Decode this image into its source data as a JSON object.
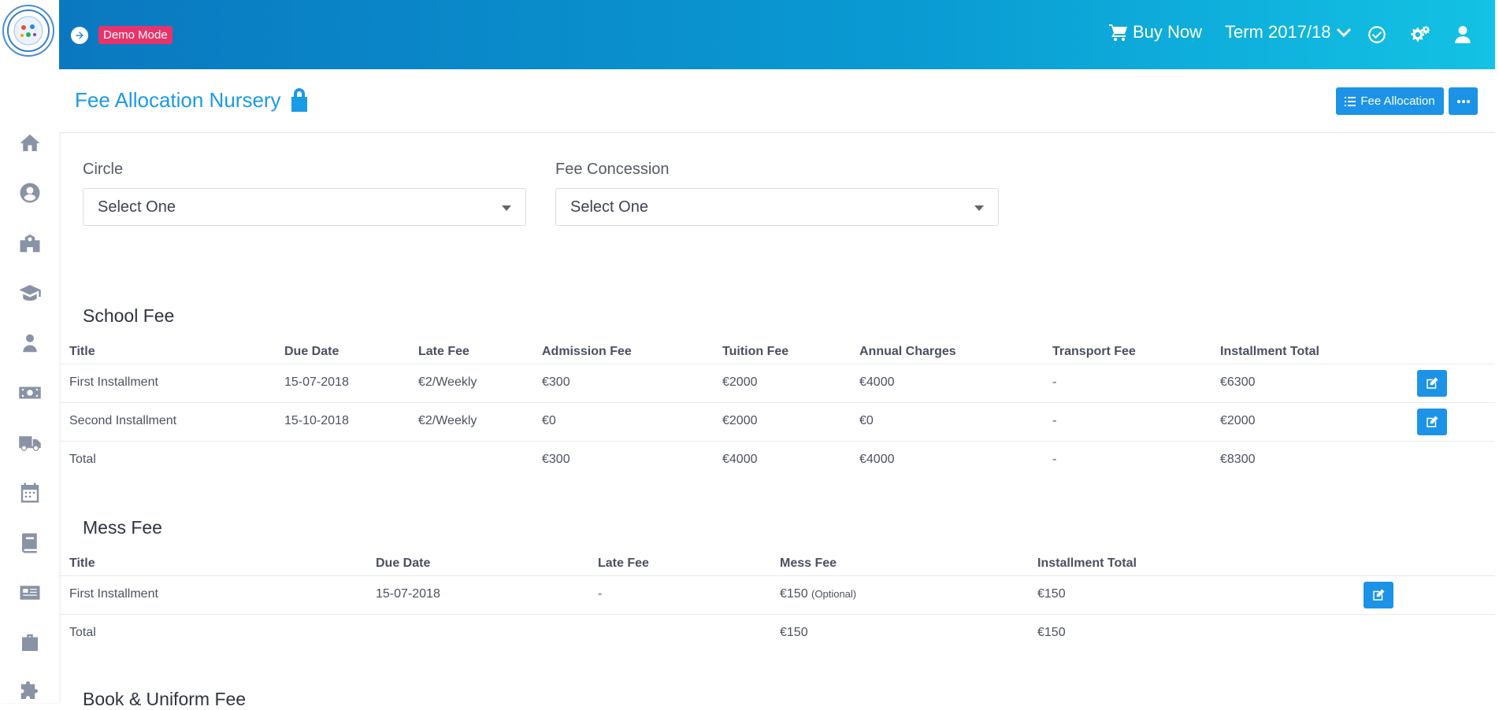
{
  "header": {
    "demo_badge": "Demo Mode",
    "buy_now": "Buy Now",
    "term": "Term 2017/18"
  },
  "page": {
    "title": "Fee Allocation Nursery",
    "fee_allocation_button": "Fee Allocation"
  },
  "filters": {
    "circle": {
      "label": "Circle",
      "value": "Select One"
    },
    "fee_concession": {
      "label": "Fee Concession",
      "value": "Select One"
    }
  },
  "school_fee": {
    "title": "School Fee",
    "columns": [
      "Title",
      "Due Date",
      "Late Fee",
      "Admission Fee",
      "Tuition Fee",
      "Annual Charges",
      "Transport Fee",
      "Installment Total"
    ],
    "rows": [
      [
        "First Installment",
        "15-07-2018",
        "€2/Weekly",
        "€300",
        "€2000",
        "€4000",
        "-",
        "€6300"
      ],
      [
        "Second Installment",
        "15-10-2018",
        "€2/Weekly",
        "€0",
        "€2000",
        "€0",
        "-",
        "€2000"
      ],
      [
        "Total",
        "",
        "",
        "€300",
        "€4000",
        "€4000",
        "-",
        "€8300"
      ]
    ]
  },
  "mess_fee": {
    "title": "Mess Fee",
    "columns": [
      "Title",
      "Due Date",
      "Late Fee",
      "Mess Fee",
      "Installment Total"
    ],
    "rows": [
      {
        "title": "First Installment",
        "due": "15-07-2018",
        "late": "-",
        "mess": "€150",
        "note": "(Optional)",
        "total": "€150"
      },
      {
        "title": "Total",
        "due": "",
        "late": "",
        "mess": "€150",
        "note": "",
        "total": "€150"
      }
    ]
  },
  "book_uniform_fee": {
    "title": "Book & Uniform Fee"
  },
  "colors": {
    "accent": "#1c93e6",
    "badge": "#e8336a",
    "header_start": "#0a78c0",
    "header_end": "#13c2e4"
  },
  "icons": [
    "home-icon",
    "user-circle-icon",
    "school-icon",
    "graduation-cap-icon",
    "teacher-icon",
    "money-icon",
    "truck-icon",
    "calendar-icon",
    "book-icon",
    "newspaper-icon",
    "briefcase-icon",
    "puzzle-icon"
  ]
}
